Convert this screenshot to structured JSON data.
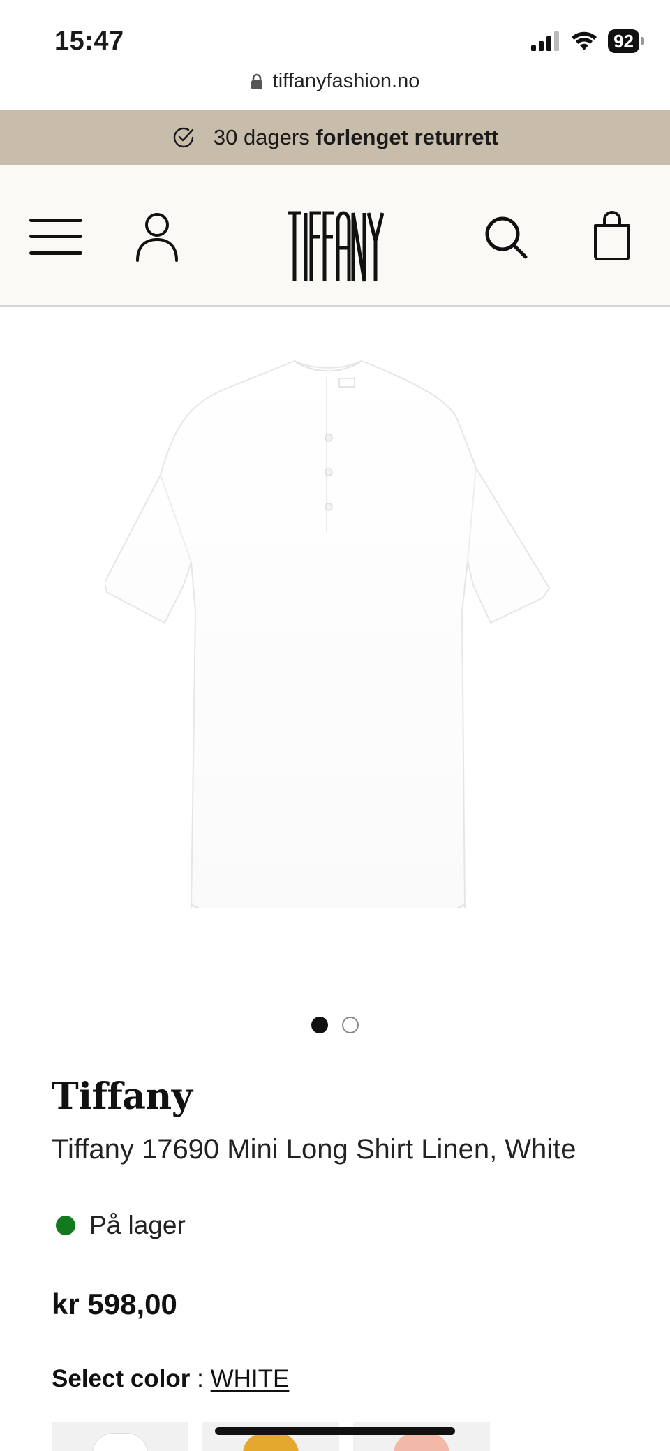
{
  "status_bar": {
    "time": "15:47",
    "battery": "92"
  },
  "browser": {
    "url": "tiffanyfashion.no"
  },
  "promo": {
    "text_regular": "30 dagers ",
    "text_bold": "forlenget returrett"
  },
  "header": {
    "logo_text": "TIFFANY"
  },
  "carousel": {
    "total": 2,
    "active_index": 0
  },
  "product": {
    "brand": "Tiffany",
    "name": "Tiffany 17690 Mini Long Shirt Linen, White",
    "stock_status": "På lager",
    "stock_color": "#127a1e",
    "price": "kr 598,00",
    "color_label": "Select color",
    "color_separator": " : ",
    "color_value": "WHITE"
  },
  "swatches": [
    {
      "color": "#ffffff"
    },
    {
      "color": "#e5a82e"
    },
    {
      "color": "#f2b8a8"
    }
  ],
  "colors": {
    "promo_bg": "#c8bcab",
    "header_bg": "#faf9f5"
  }
}
